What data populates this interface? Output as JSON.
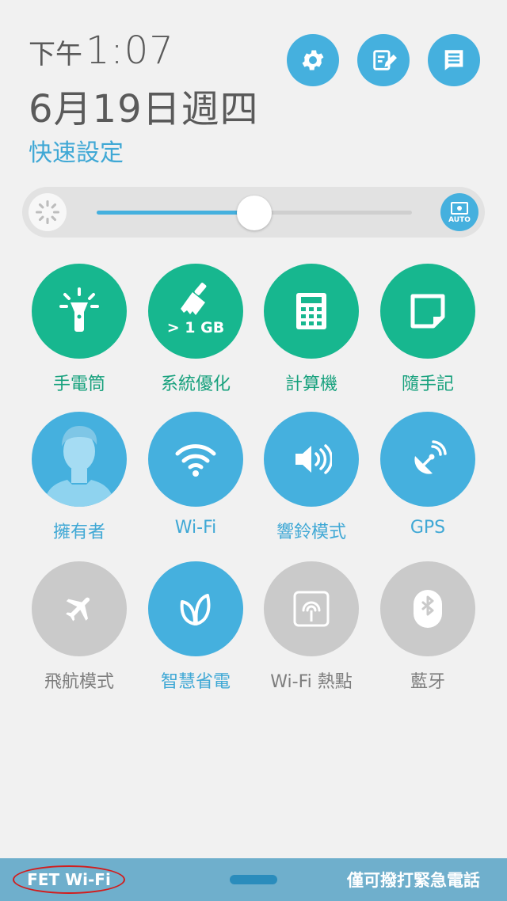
{
  "header": {
    "time_prefix": "下午",
    "time": "1:07",
    "date": "6月19日週四",
    "quick_settings_title": "快速設定"
  },
  "top_buttons": [
    {
      "icon": "gear-icon"
    },
    {
      "icon": "edit-icon"
    },
    {
      "icon": "notes-icon"
    }
  ],
  "brightness": {
    "level": 0.5,
    "auto_label": "AUTO"
  },
  "tiles": [
    {
      "label": "手電筒",
      "icon": "flashlight-icon",
      "state": "green"
    },
    {
      "label": "系統優化",
      "icon": "broom-icon",
      "state": "green",
      "badge": "> 1 GB"
    },
    {
      "label": "計算機",
      "icon": "calculator-icon",
      "state": "green"
    },
    {
      "label": "隨手記",
      "icon": "sticky-note-icon",
      "state": "green"
    },
    {
      "label": "擁有者",
      "icon": "owner-avatar-icon",
      "state": "blue"
    },
    {
      "label": "Wi-Fi",
      "icon": "wifi-icon",
      "state": "blue"
    },
    {
      "label": "響鈴模式",
      "icon": "ringer-icon",
      "state": "blue"
    },
    {
      "label": "GPS",
      "icon": "gps-icon",
      "state": "blue"
    },
    {
      "label": "飛航模式",
      "icon": "airplane-icon",
      "state": "gray"
    },
    {
      "label": "智慧省電",
      "icon": "leaf-icon",
      "state": "blue"
    },
    {
      "label": "Wi-Fi 熱點",
      "icon": "hotspot-icon",
      "state": "gray"
    },
    {
      "label": "藍牙",
      "icon": "bluetooth-icon",
      "state": "gray"
    }
  ],
  "bottom_bar": {
    "carrier": "FET Wi-Fi",
    "emergency": "僅可撥打緊急電話"
  },
  "colors": {
    "accent_blue": "#45b0de",
    "accent_green": "#17b78f",
    "disabled_gray": "#cacaca"
  }
}
